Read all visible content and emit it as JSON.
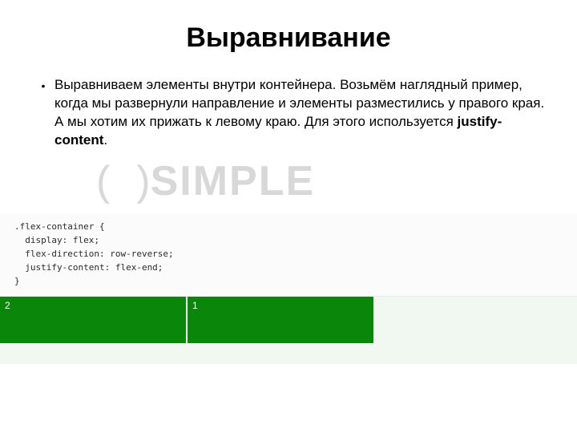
{
  "title": "Выравнивание",
  "bullet": {
    "marker": "•",
    "text_pre": "Выравниваем элементы внутри контейнера. Возьмём наглядный пример, когда мы развернули направление и элементы разместились у правого края. А мы хотим их прижать к левому краю. Для этого используется ",
    "text_bold": "justify-content",
    "text_post": "."
  },
  "watermark": {
    "paren_open": "(",
    "paren_close": ")",
    "word": "SIMPLE"
  },
  "code": ".flex-container {\n  display: flex;\n  flex-direction: row-reverse;\n  justify-content: flex-end;\n}",
  "demo": {
    "items": [
      "1",
      "2"
    ]
  }
}
